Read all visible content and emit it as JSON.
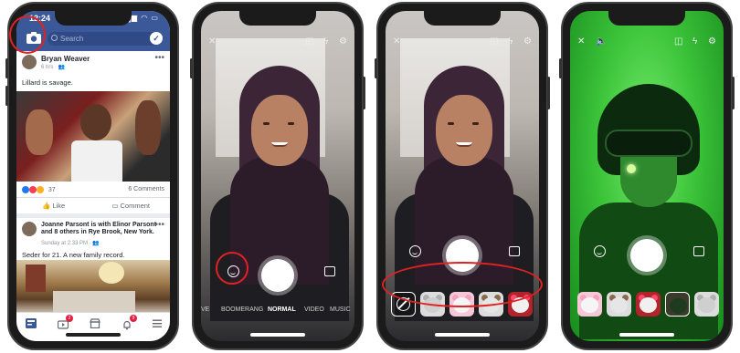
{
  "status": {
    "time": "12:24",
    "icons": "▂▄▆ ◠ ▭"
  },
  "feed": {
    "search_placeholder": "Search",
    "messenger_glyph": "✓",
    "post1": {
      "author": "Bryan Weaver",
      "meta": "6 hrs · ",
      "text": "Lillard is savage.",
      "reaction_count": "37",
      "comments": "6 Comments",
      "menu_glyph": "•••"
    },
    "actions": {
      "like": "Like",
      "comment": "Comment"
    },
    "post2": {
      "author_line": "Joanne Parsont is with Elinor Parsont and 8 others in Rye Brook, New York.",
      "meta": "Sunday at 2:33 PM · ",
      "text": "Seder for 21. A new family record.",
      "menu_glyph": "•••"
    },
    "tab_badges": [
      "2",
      "9"
    ]
  },
  "camera": {
    "close_glyph": "✕",
    "modes": [
      "VE",
      "BOOMERANG",
      "NORMAL",
      "VIDEO",
      "MUSIC"
    ],
    "active_mode": "NORMAL"
  },
  "colors": {
    "facebook_blue": "#3b5998",
    "annotation_red": "#e02222",
    "night_vision_green": "#3cc43a"
  }
}
